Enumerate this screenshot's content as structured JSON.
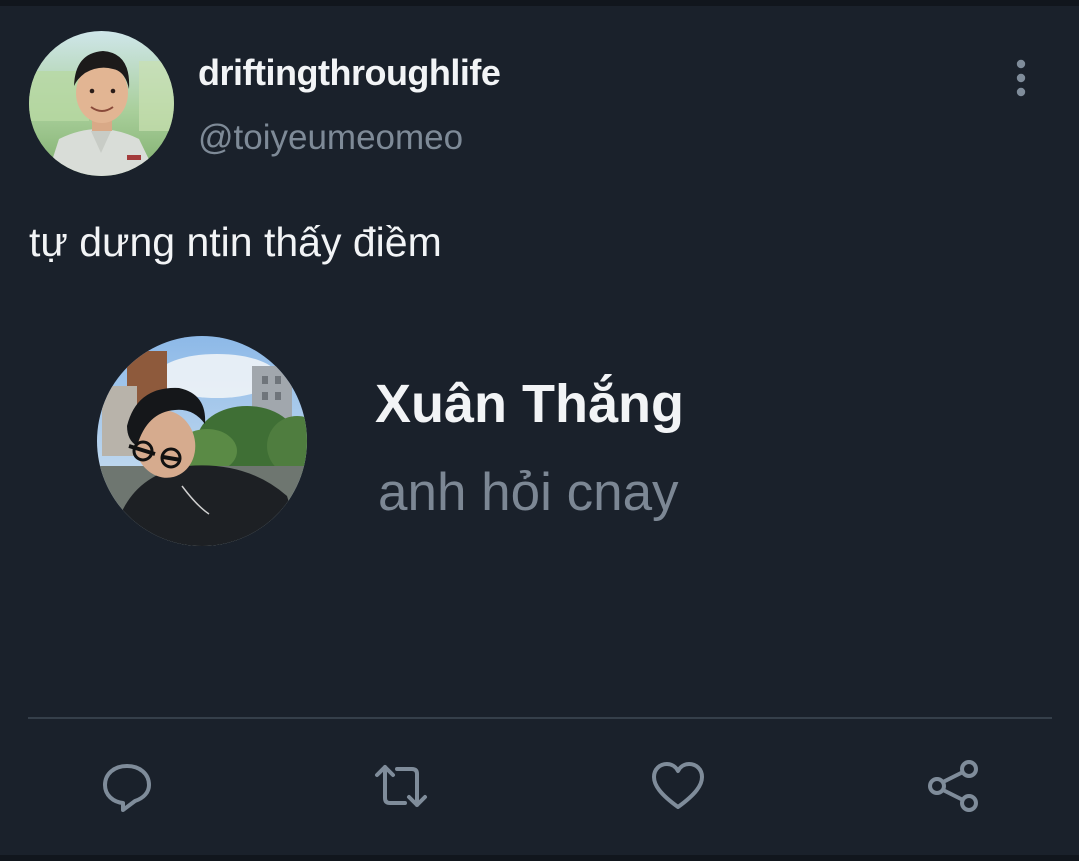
{
  "tweet": {
    "author": {
      "display_name": "driftingthroughlife",
      "handle": "@toiyeumeomeo",
      "avatar_icon": "profile-photo"
    },
    "text": "tự dưng ntin thấy điềm",
    "embedded_message": {
      "name": "Xuân Thắng",
      "message": "anh hỏi cnay",
      "avatar_icon": "profile-photo"
    },
    "actions": {
      "reply_icon": "reply-icon",
      "retweet_icon": "retweet-icon",
      "like_icon": "heart-icon",
      "share_icon": "share-icon"
    },
    "more_icon": "more-vertical-icon"
  },
  "colors": {
    "background": "#1a212b",
    "text_primary": "#f2f4f6",
    "text_secondary": "#7e8a97",
    "icon": "#7f8c9a",
    "divider": "#353f4a"
  }
}
